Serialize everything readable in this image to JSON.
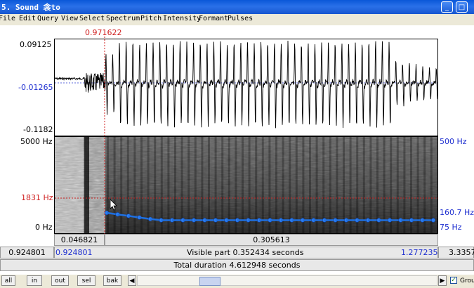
{
  "window": {
    "title": "5. Sound 衾to"
  },
  "menu": [
    "File",
    "Edit",
    "Query",
    "View",
    "Select",
    "Spectrum",
    "Pitch",
    "Intensity",
    "Formant",
    "Pulses"
  ],
  "cursor_time": "0.971622",
  "waveform": {
    "max": "0.09125",
    "mid": "-0.01265",
    "min": "-0.1182"
  },
  "spectrogram": {
    "top_freq": "5000 Hz",
    "cursor_freq": "1831 Hz",
    "bottom_freq": "0 Hz"
  },
  "pitch_axis": {
    "top": "500 Hz",
    "value": "160.7 Hz",
    "bottom": "75 Hz"
  },
  "selection": {
    "left_segment": "0.046821",
    "right_segment": "0.305613"
  },
  "visible": {
    "start": "0.924801",
    "start_blue": "0.924801",
    "label": "Visible part 0.352434 seconds",
    "end_blue": "1.277235",
    "end": "3.3357"
  },
  "total": {
    "label": "Total duration 4.612948 seconds"
  },
  "buttons": {
    "all": "all",
    "in": "in",
    "out": "out",
    "sel": "sel",
    "bak": "bak"
  },
  "group": {
    "label": "Group",
    "checked": true
  },
  "colors": {
    "title_bar": "#0a58d8",
    "cursor": "#d02020",
    "pitch": "#1e6fe0",
    "axis_blue": "#1e2fd0"
  }
}
